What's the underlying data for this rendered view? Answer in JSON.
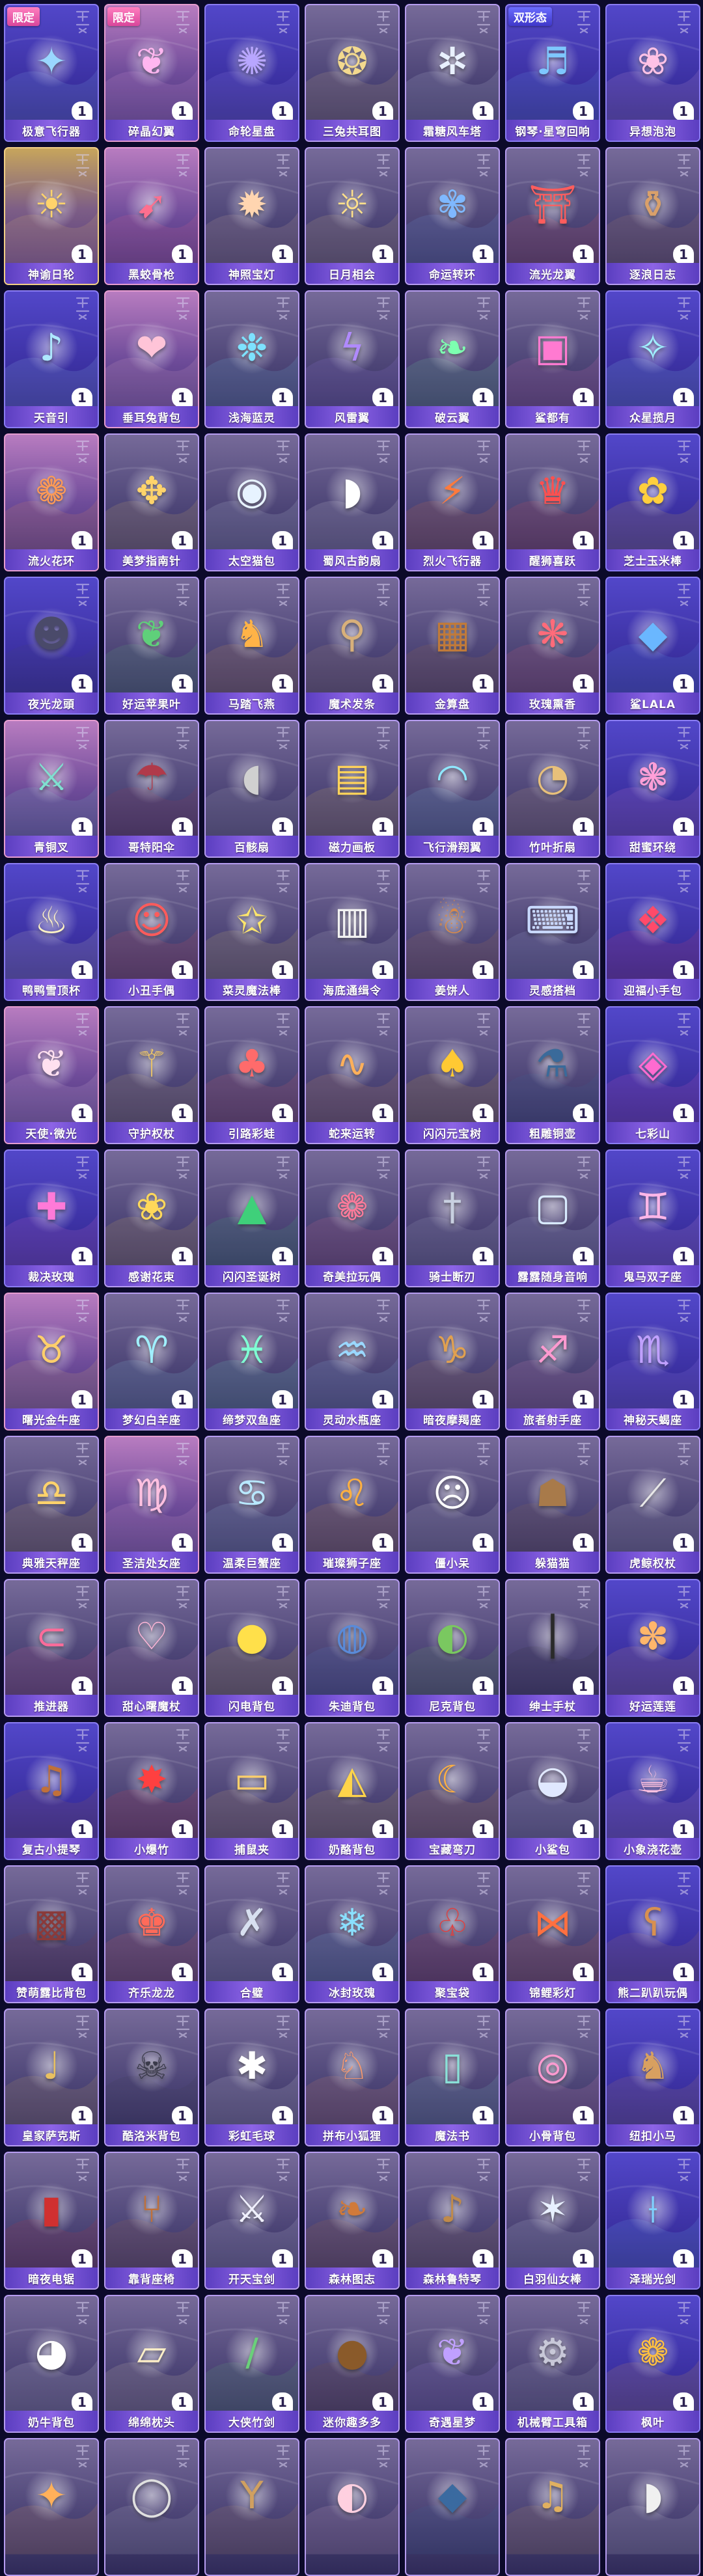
{
  "colors": {
    "page_bg": "#0c0a2a",
    "name_bar": "#7a55dd",
    "badge_pink": "#e0559f",
    "badge_blue": "#4b47d4",
    "quantity_bg": "#ffffff"
  },
  "items": [
    {
      "name": "极意飞行器",
      "qty": "1",
      "badge": "限定",
      "tone": "blue",
      "icon": "wing-glider-icon",
      "glyph": "✦",
      "tint": "#9ad7ff"
    },
    {
      "name": "碎晶幻翼",
      "qty": "1",
      "badge": "限定",
      "tone": "pink",
      "icon": "crystal-wings-icon",
      "glyph": "❦",
      "tint": "#ffb6f0"
    },
    {
      "name": "命轮星盘",
      "qty": "1",
      "tone": "blue",
      "icon": "star-disc-icon",
      "glyph": "✺",
      "tint": "#b8a6ff"
    },
    {
      "name": "三兔共耳图",
      "qty": "1",
      "tone": "gray",
      "icon": "rabbit-medallion-icon",
      "glyph": "❂",
      "tint": "#f3d98e"
    },
    {
      "name": "霜糖风车塔",
      "qty": "1",
      "tone": "gray",
      "icon": "windmill-tower-icon",
      "glyph": "✲",
      "tint": "#e9f1ff"
    },
    {
      "name": "钢琴·星穹回响",
      "qty": "1",
      "badge": "双形态",
      "badge_tone": "blue",
      "tone": "blue",
      "icon": "piano-icon",
      "glyph": "♬",
      "tint": "#7ec7ff"
    },
    {
      "name": "异想泡泡",
      "qty": "1",
      "tone": "blue",
      "icon": "bubble-icon",
      "glyph": "❀",
      "tint": "#ffc2e6"
    },
    {
      "name": "神谕日轮",
      "qty": "1",
      "tone": "gold",
      "icon": "sun-scepter-icon",
      "glyph": "☀",
      "tint": "#ffd36b"
    },
    {
      "name": "黑蛟骨枪",
      "qty": "1",
      "tone": "pink",
      "icon": "spear-icon",
      "glyph": "➹",
      "tint": "#ff6f8f"
    },
    {
      "name": "神照宝灯",
      "qty": "1",
      "tone": "gray",
      "icon": "lantern-icon",
      "glyph": "✹",
      "tint": "#ffd5b0"
    },
    {
      "name": "日月相会",
      "qty": "1",
      "tone": "gray",
      "icon": "sun-moon-icon",
      "glyph": "☼",
      "tint": "#ffe08a"
    },
    {
      "name": "命运转环",
      "qty": "1",
      "tone": "gray",
      "icon": "fan-icon",
      "glyph": "✾",
      "tint": "#7fb8ff"
    },
    {
      "name": "流光龙翼",
      "qty": "1",
      "tone": "gray",
      "icon": "red-shrine-icon",
      "glyph": "⛩",
      "tint": "#ff5d5d"
    },
    {
      "name": "逐浪日志",
      "qty": "1",
      "tone": "gray",
      "icon": "clay-pot-icon",
      "glyph": "⚱",
      "tint": "#d9a06a"
    },
    {
      "name": "天音引",
      "qty": "1",
      "tone": "blue",
      "icon": "music-wand-icon",
      "glyph": "♪",
      "tint": "#aee8ff"
    },
    {
      "name": "垂耳兔背包",
      "qty": "1",
      "tone": "pink",
      "icon": "bunny-backpack-icon",
      "glyph": "❤",
      "tint": "#ffc4d8"
    },
    {
      "name": "浅海蓝灵",
      "qty": "1",
      "tone": "gray",
      "icon": "jellyfish-icon",
      "glyph": "❉",
      "tint": "#7de2ff"
    },
    {
      "name": "风雷翼",
      "qty": "1",
      "tone": "gray",
      "icon": "thunder-wings-icon",
      "glyph": "ϟ",
      "tint": "#b08aff"
    },
    {
      "name": "破云翼",
      "qty": "1",
      "tone": "gray",
      "icon": "green-wings-icon",
      "glyph": "❧",
      "tint": "#7dffb0"
    },
    {
      "name": "鲨都有",
      "qty": "1",
      "tone": "gray",
      "icon": "arcade-machine-icon",
      "glyph": "▣",
      "tint": "#ff7ad1"
    },
    {
      "name": "众星揽月",
      "qty": "1",
      "tone": "blue",
      "icon": "star-orb-icon",
      "glyph": "✧",
      "tint": "#9ff0ff"
    },
    {
      "name": "流火花环",
      "qty": "1",
      "tone": "pink",
      "icon": "fire-wreath-icon",
      "glyph": "❁",
      "tint": "#ff9a55"
    },
    {
      "name": "美梦指南针",
      "qty": "1",
      "tone": "gray",
      "icon": "compass-icon",
      "glyph": "✥",
      "tint": "#ffd46b"
    },
    {
      "name": "太空猫包",
      "qty": "1",
      "tone": "gray",
      "icon": "astronaut-backpack-icon",
      "glyph": "◉",
      "tint": "#e7f3ff"
    },
    {
      "name": "蜀风古韵扇",
      "qty": "1",
      "tone": "gray",
      "icon": "folding-fan-icon",
      "glyph": "◗",
      "tint": "#ffffff"
    },
    {
      "name": "烈火飞行器",
      "qty": "1",
      "tone": "gray",
      "icon": "fire-glider-icon",
      "glyph": "⚡",
      "tint": "#ff7a3d"
    },
    {
      "name": "醒狮喜跃",
      "qty": "1",
      "tone": "gray",
      "icon": "lion-dance-icon",
      "glyph": "♛",
      "tint": "#ff5050"
    },
    {
      "name": "芝士玉米棒",
      "qty": "1",
      "tone": "blue",
      "icon": "corn-icon",
      "glyph": "✿",
      "tint": "#ffcf3d"
    },
    {
      "name": "夜光龙頭",
      "qty": "1",
      "tone": "blue",
      "icon": "dragon-head-icon",
      "glyph": "☻",
      "tint": "#4a4a6a"
    },
    {
      "name": "好运苹果叶",
      "qty": "1",
      "tone": "gray",
      "icon": "leaf-icon",
      "glyph": "❦",
      "tint": "#5fd07a"
    },
    {
      "name": "马踏飞燕",
      "qty": "1",
      "tone": "gray",
      "icon": "horse-icon",
      "glyph": "♞",
      "tint": "#ffb347"
    },
    {
      "name": "魔术发条",
      "qty": "1",
      "tone": "gray",
      "icon": "wind-up-key-icon",
      "glyph": "⚲",
      "tint": "#d8b07a"
    },
    {
      "name": "金算盘",
      "qty": "1",
      "tone": "gray",
      "icon": "abacus-icon",
      "glyph": "▦",
      "tint": "#c07a3a"
    },
    {
      "name": "玫瑰熏香",
      "qty": "1",
      "tone": "gray",
      "icon": "incense-icon",
      "glyph": "❋",
      "tint": "#ff6b7a"
    },
    {
      "name": "鲨LALA",
      "qty": "1",
      "tone": "blue",
      "icon": "shark-icon",
      "glyph": "◆",
      "tint": "#6ab7ff"
    },
    {
      "name": "青铜叉",
      "qty": "1",
      "tone": "pink",
      "icon": "trident-icon",
      "glyph": "⚔",
      "tint": "#7fe0d0"
    },
    {
      "name": "哥特阳伞",
      "qty": "1",
      "tone": "gray",
      "icon": "parasol-icon",
      "glyph": "☂",
      "tint": "#b03a4a"
    },
    {
      "name": "百骸扇",
      "qty": "1",
      "tone": "gray",
      "icon": "bone-fan-icon",
      "glyph": "◖",
      "tint": "#d0d0d0"
    },
    {
      "name": "磁力画板",
      "qty": "1",
      "tone": "gray",
      "icon": "drawing-board-icon",
      "glyph": "▤",
      "tint": "#ffd25a"
    },
    {
      "name": "飞行滑翔翼",
      "qty": "1",
      "tone": "gray",
      "icon": "hang-glider-icon",
      "glyph": "◠",
      "tint": "#8fe8ff"
    },
    {
      "name": "竹叶折扇",
      "qty": "1",
      "tone": "gray",
      "icon": "bamboo-fan-icon",
      "glyph": "◔",
      "tint": "#e8c07a"
    },
    {
      "name": "甜蜜环绕",
      "qty": "1",
      "tone": "blue",
      "icon": "candy-ring-icon",
      "glyph": "❃",
      "tint": "#ff9fd8"
    },
    {
      "name": "鸭鸭雪顶杯",
      "qty": "1",
      "tone": "blue",
      "icon": "ice-cream-cup-icon",
      "glyph": "♨",
      "tint": "#fff3c4"
    },
    {
      "name": "小丑手偶",
      "qty": "1",
      "tone": "gray",
      "icon": "clown-puppet-icon",
      "glyph": "☺",
      "tint": "#ff5b5b"
    },
    {
      "name": "菜灵魔法棒",
      "qty": "1",
      "tone": "gray",
      "icon": "magic-wand-icon",
      "glyph": "✩",
      "tint": "#ffe66b"
    },
    {
      "name": "海底通缉令",
      "qty": "1",
      "tone": "gray",
      "icon": "wanted-poster-icon",
      "glyph": "▥",
      "tint": "#f2f2f2"
    },
    {
      "name": "姜饼人",
      "qty": "1",
      "tone": "gray",
      "icon": "gingerbread-icon",
      "glyph": "☃",
      "tint": "#d88a4a"
    },
    {
      "name": "灵感搭档",
      "qty": "1",
      "tone": "gray",
      "icon": "typewriter-icon",
      "glyph": "⌨",
      "tint": "#c8d8ff"
    },
    {
      "name": "迎福小手包",
      "qty": "1",
      "tone": "blue",
      "icon": "red-handbag-icon",
      "glyph": "❖",
      "tint": "#ff4a6a"
    },
    {
      "name": "天使·微光",
      "qty": "1",
      "tone": "pink",
      "icon": "angel-wings-icon",
      "glyph": "❦",
      "tint": "#ffe0f0"
    },
    {
      "name": "守护权杖",
      "qty": "1",
      "tone": "gray",
      "icon": "guardian-staff-icon",
      "glyph": "⚚",
      "tint": "#e8c26a"
    },
    {
      "name": "引路彩蛙",
      "qty": "1",
      "tone": "gray",
      "icon": "frog-icon",
      "glyph": "♣",
      "tint": "#ff6b6b"
    },
    {
      "name": "蛇来运转",
      "qty": "1",
      "tone": "gray",
      "icon": "snake-icon",
      "glyph": "∿",
      "tint": "#ffb05a"
    },
    {
      "name": "闪闪元宝树",
      "qty": "1",
      "tone": "gray",
      "icon": "gold-tree-icon",
      "glyph": "♠",
      "tint": "#ffc933"
    },
    {
      "name": "粗雕铜壶",
      "qty": "1",
      "tone": "gray",
      "icon": "teapot-icon",
      "glyph": "⚗",
      "tint": "#3a6a9a"
    },
    {
      "name": "七彩山",
      "qty": "1",
      "tone": "blue",
      "icon": "rainbow-gem-icon",
      "glyph": "◈",
      "tint": "#ff6bd0"
    },
    {
      "name": "裁决玫瑰",
      "qty": "1",
      "tone": "blue",
      "icon": "rose-blade-icon",
      "glyph": "✚",
      "tint": "#ff7ad8"
    },
    {
      "name": "感谢花束",
      "qty": "1",
      "tone": "gray",
      "icon": "bouquet-icon",
      "glyph": "❀",
      "tint": "#ffd85a"
    },
    {
      "name": "闪闪圣诞树",
      "qty": "1",
      "tone": "gray",
      "icon": "christmas-tree-icon",
      "glyph": "▲",
      "tint": "#3fd07a"
    },
    {
      "name": "奇美拉玩偶",
      "qty": "1",
      "tone": "gray",
      "icon": "chimera-plush-icon",
      "glyph": "❁",
      "tint": "#ff7a9a"
    },
    {
      "name": "骑士断刃",
      "qty": "1",
      "tone": "gray",
      "icon": "broken-sword-icon",
      "glyph": "†",
      "tint": "#c8d0e0"
    },
    {
      "name": "露露随身音响",
      "qty": "1",
      "tone": "gray",
      "icon": "speaker-icon",
      "glyph": "▢",
      "tint": "#d8eaff"
    },
    {
      "name": "鬼马双子座",
      "qty": "1",
      "tone": "blue",
      "icon": "gemini-icon",
      "glyph": "♊",
      "tint": "#ffb6e8"
    },
    {
      "name": "曙光金牛座",
      "qty": "1",
      "tone": "pink",
      "icon": "taurus-icon",
      "glyph": "♉",
      "tint": "#ffcf6b"
    },
    {
      "name": "梦幻白羊座",
      "qty": "1",
      "tone": "gray",
      "icon": "aries-icon",
      "glyph": "♈",
      "tint": "#a0f0ff"
    },
    {
      "name": "缔梦双鱼座",
      "qty": "1",
      "tone": "gray",
      "icon": "pisces-icon",
      "glyph": "♓",
      "tint": "#7fffd4"
    },
    {
      "name": "灵动水瓶座",
      "qty": "1",
      "tone": "gray",
      "icon": "aquarius-icon",
      "glyph": "♒",
      "tint": "#9ad8ff"
    },
    {
      "name": "暗夜摩羯座",
      "qty": "1",
      "tone": "gray",
      "icon": "capricorn-icon",
      "glyph": "♑",
      "tint": "#e0a050"
    },
    {
      "name": "旅者射手座",
      "qty": "1",
      "tone": "gray",
      "icon": "sagittarius-icon",
      "glyph": "♐",
      "tint": "#ff9ad0"
    },
    {
      "name": "神秘天蝎座",
      "qty": "1",
      "tone": "blue",
      "icon": "scorpio-icon",
      "glyph": "♏",
      "tint": "#c0a0ff"
    },
    {
      "name": "典雅天秤座",
      "qty": "1",
      "tone": "gray",
      "icon": "libra-icon",
      "glyph": "♎",
      "tint": "#ffd36b"
    },
    {
      "name": "圣洁处女座",
      "qty": "1",
      "tone": "pink",
      "icon": "virgo-icon",
      "glyph": "♍",
      "tint": "#ffc0e0"
    },
    {
      "name": "温柔巨蟹座",
      "qty": "1",
      "tone": "gray",
      "icon": "cancer-icon",
      "glyph": "♋",
      "tint": "#b8e8ff"
    },
    {
      "name": "璀璨狮子座",
      "qty": "1",
      "tone": "gray",
      "icon": "leo-icon",
      "glyph": "♌",
      "tint": "#ffb040"
    },
    {
      "name": "僵小呆",
      "qty": "1",
      "tone": "gray",
      "icon": "jiangshi-icon",
      "glyph": "☹",
      "tint": "#ffffff"
    },
    {
      "name": "躲猫猫",
      "qty": "1",
      "tone": "gray",
      "icon": "hide-cat-icon",
      "glyph": "☗",
      "tint": "#a87a4a"
    },
    {
      "name": "虎鲸权杖",
      "qty": "1",
      "tone": "gray",
      "icon": "orca-staff-icon",
      "glyph": "⟋",
      "tint": "#e8e8e8"
    },
    {
      "name": "推进器",
      "qty": "1",
      "tone": "gray",
      "icon": "thruster-icon",
      "glyph": "⊂",
      "tint": "#ff6b9a"
    },
    {
      "name": "甜心曙魔杖",
      "qty": "1",
      "tone": "gray",
      "icon": "heart-wand-icon",
      "glyph": "♡",
      "tint": "#ffb6d8"
    },
    {
      "name": "闪电背包",
      "qty": "1",
      "tone": "gray",
      "icon": "lightning-backpack-icon",
      "glyph": "●",
      "tint": "#ffe04a"
    },
    {
      "name": "朱迪背包",
      "qty": "1",
      "tone": "gray",
      "icon": "bunny-cop-backpack-icon",
      "glyph": "◍",
      "tint": "#5a8ad8"
    },
    {
      "name": "尼克背包",
      "qty": "1",
      "tone": "gray",
      "icon": "fox-backpack-icon",
      "glyph": "◐",
      "tint": "#7ac860"
    },
    {
      "name": "绅士手杖",
      "qty": "1",
      "tone": "gray",
      "icon": "cane-icon",
      "glyph": "⎮",
      "tint": "#2a2a2a"
    },
    {
      "name": "好运莲莲",
      "qty": "1",
      "tone": "blue",
      "icon": "lotus-icon",
      "glyph": "✽",
      "tint": "#ffb66b"
    },
    {
      "name": "复古小提琴",
      "qty": "1",
      "tone": "blue",
      "icon": "violin-icon",
      "glyph": "♫",
      "tint": "#c0703a"
    },
    {
      "name": "小爆竹",
      "qty": "1",
      "tone": "gray",
      "icon": "firecracker-icon",
      "glyph": "✸",
      "tint": "#ff4040"
    },
    {
      "name": "捕鼠夹",
      "qty": "1",
      "tone": "gray",
      "icon": "mousetrap-icon",
      "glyph": "▭",
      "tint": "#ffd06b"
    },
    {
      "name": "奶酪背包",
      "qty": "1",
      "tone": "gray",
      "icon": "cheese-backpack-icon",
      "glyph": "◭",
      "tint": "#ffd44a"
    },
    {
      "name": "宝藏弯刀",
      "qty": "1",
      "tone": "gray",
      "icon": "scimitar-icon",
      "glyph": "☾",
      "tint": "#ffb040"
    },
    {
      "name": "小鲨包",
      "qty": "1",
      "tone": "gray",
      "icon": "shark-bag-icon",
      "glyph": "◒",
      "tint": "#e0e8ff"
    },
    {
      "name": "小象浇花壶",
      "qty": "1",
      "tone": "blue",
      "icon": "watering-can-icon",
      "glyph": "☕",
      "tint": "#ffc0e0"
    },
    {
      "name": "赞萌露比背包",
      "qty": "1",
      "tone": "gray",
      "icon": "suitcase-icon",
      "glyph": "▩",
      "tint": "#8a3a3a"
    },
    {
      "name": "齐乐龙龙",
      "qty": "1",
      "tone": "gray",
      "icon": "dragon-doll-icon",
      "glyph": "♚",
      "tint": "#ff6b5a"
    },
    {
      "name": "合璧",
      "qty": "1",
      "tone": "gray",
      "icon": "twin-blades-icon",
      "glyph": "✗",
      "tint": "#d8e0f0"
    },
    {
      "name": "冰封玫瑰",
      "qty": "1",
      "tone": "gray",
      "icon": "frozen-rose-icon",
      "glyph": "❄",
      "tint": "#8ae0ff"
    },
    {
      "name": "聚宝袋",
      "qty": "1",
      "tone": "gray",
      "icon": "treasure-bag-icon",
      "glyph": "♧",
      "tint": "#e04040"
    },
    {
      "name": "锦鲤彩灯",
      "qty": "1",
      "tone": "gray",
      "icon": "koi-lantern-icon",
      "glyph": "⋈",
      "tint": "#ff7040"
    },
    {
      "name": "熊二趴趴玩偶",
      "qty": "1",
      "tone": "blue",
      "icon": "bear-plush-icon",
      "glyph": "ʕ",
      "tint": "#d89050"
    },
    {
      "name": "皇家萨克斯",
      "qty": "1",
      "tone": "gray",
      "icon": "saxophone-icon",
      "glyph": "♩",
      "tint": "#e8c060"
    },
    {
      "name": "酷洛米背包",
      "qty": "1",
      "tone": "gray",
      "icon": "kuromi-backpack-icon",
      "glyph": "☠",
      "tint": "#3a3a4a"
    },
    {
      "name": "彩虹毛球",
      "qty": "1",
      "tone": "gray",
      "icon": "fluff-ball-icon",
      "glyph": "✱",
      "tint": "#ffffff"
    },
    {
      "name": "拼布小狐狸",
      "qty": "1",
      "tone": "gray",
      "icon": "patchwork-fox-icon",
      "glyph": "♘",
      "tint": "#ff9a6b"
    },
    {
      "name": "魔法书",
      "qty": "1",
      "tone": "gray",
      "icon": "spellbook-icon",
      "glyph": "▯",
      "tint": "#8ae0d8"
    },
    {
      "name": "小骨背包",
      "qty": "1",
      "tone": "gray",
      "icon": "bone-backpack-icon",
      "glyph": "◎",
      "tint": "#ff9ad0"
    },
    {
      "name": "纽扣小马",
      "qty": "1",
      "tone": "blue",
      "icon": "button-pony-icon",
      "glyph": "♞",
      "tint": "#d8a060"
    },
    {
      "name": "暗夜电锯",
      "qty": "1",
      "tone": "gray",
      "icon": "chainsaw-icon",
      "glyph": "▮",
      "tint": "#d03030"
    },
    {
      "name": "靠背座椅",
      "qty": "1",
      "tone": "gray",
      "icon": "chair-icon",
      "glyph": "⑂",
      "tint": "#c0703a"
    },
    {
      "name": "开天宝剑",
      "qty": "1",
      "tone": "gray",
      "icon": "sword-icon",
      "glyph": "⚔",
      "tint": "#f0f0ff"
    },
    {
      "name": "森林图志",
      "qty": "1",
      "tone": "gray",
      "icon": "forest-book-icon",
      "glyph": "❧",
      "tint": "#d07a3a"
    },
    {
      "name": "森林鲁特琴",
      "qty": "1",
      "tone": "gray",
      "icon": "lute-icon",
      "glyph": "♪",
      "tint": "#c08a4a"
    },
    {
      "name": "白羽仙女棒",
      "qty": "1",
      "tone": "gray",
      "icon": "feather-wand-icon",
      "glyph": "✶",
      "tint": "#e8f0ff"
    },
    {
      "name": "泽瑞光剑",
      "qty": "1",
      "tone": "blue",
      "icon": "light-saber-icon",
      "glyph": "⟊",
      "tint": "#7fd0ff"
    },
    {
      "name": "奶牛背包",
      "qty": "1",
      "tone": "gray",
      "icon": "cow-backpack-icon",
      "glyph": "◕",
      "tint": "#ffffff"
    },
    {
      "name": "绵绵枕头",
      "qty": "1",
      "tone": "gray",
      "icon": "pillow-icon",
      "glyph": "▱",
      "tint": "#fff0c8"
    },
    {
      "name": "大侠竹剑",
      "qty": "1",
      "tone": "gray",
      "icon": "bamboo-sword-icon",
      "glyph": "∕",
      "tint": "#6ad07a"
    },
    {
      "name": "迷你趣多多",
      "qty": "1",
      "tone": "gray",
      "icon": "cookie-icon",
      "glyph": "●",
      "tint": "#8a5a2a"
    },
    {
      "name": "奇遇星梦",
      "qty": "1",
      "tone": "gray",
      "icon": "star-butterfly-icon",
      "glyph": "❦",
      "tint": "#c0a0ff"
    },
    {
      "name": "机械臂工具箱",
      "qty": "1",
      "tone": "gray",
      "icon": "robot-arm-icon",
      "glyph": "⚙",
      "tint": "#c8c8d8"
    },
    {
      "name": "枫叶",
      "qty": "1",
      "tone": "blue",
      "icon": "maple-leaf-icon",
      "glyph": "❁",
      "tint": "#ffc040"
    }
  ],
  "partial_row": [
    {
      "tone": "gray",
      "icon": "torch-icon",
      "glyph": "✦",
      "tint": "#ffb05a"
    },
    {
      "tone": "gray",
      "icon": "magnifier-icon",
      "glyph": "◯",
      "tint": "#e0e0e0"
    },
    {
      "tone": "gray",
      "icon": "slingshot-icon",
      "glyph": "Y",
      "tint": "#d0a060"
    },
    {
      "tone": "gray",
      "icon": "moon-rabbit-icon",
      "glyph": "◐",
      "tint": "#ffd0e0"
    },
    {
      "tone": "gray",
      "icon": "whale-icon",
      "glyph": "◆",
      "tint": "#3a6aa0"
    },
    {
      "tone": "gray",
      "icon": "guitar-icon",
      "glyph": "♫",
      "tint": "#e0b060"
    },
    {
      "tone": "gray",
      "icon": "paper-fan-icon",
      "glyph": "◗",
      "tint": "#f0f0f0"
    },
    {
      "tone": "blue",
      "icon": "chick-icon",
      "glyph": "●",
      "tint": "#ffe066"
    }
  ]
}
